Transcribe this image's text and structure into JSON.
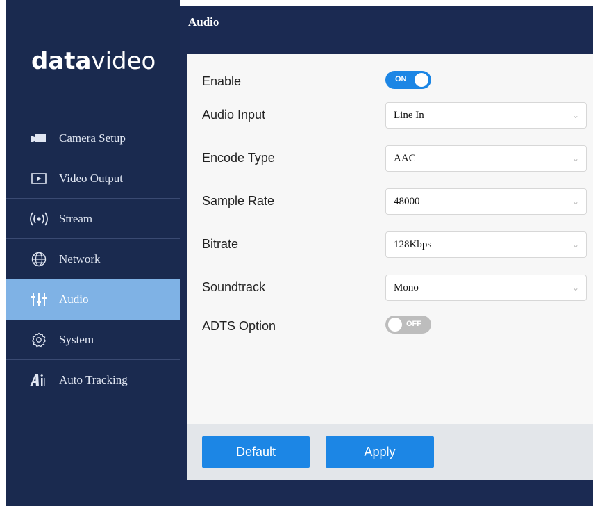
{
  "app": {
    "logo_bold": "data",
    "logo_light": "video",
    "accent": "#1c86e5",
    "sidebar_bg": "#1a2a4f",
    "active_bg": "#7fb2e5"
  },
  "sidebar": {
    "items": [
      {
        "label": "Camera Setup",
        "icon": "camera-icon",
        "active": false
      },
      {
        "label": "Video Output",
        "icon": "video-output-icon",
        "active": false
      },
      {
        "label": "Stream",
        "icon": "stream-icon",
        "active": false
      },
      {
        "label": "Network",
        "icon": "globe-icon",
        "active": false
      },
      {
        "label": "Audio",
        "icon": "audio-sliders-icon",
        "active": true
      },
      {
        "label": "System",
        "icon": "gear-icon",
        "active": false
      },
      {
        "label": "Auto Tracking",
        "icon": "ai-icon",
        "active": false
      }
    ]
  },
  "header": {
    "title": "Audio"
  },
  "form": {
    "enable": {
      "label": "Enable",
      "state": "ON"
    },
    "audio_input": {
      "label": "Audio Input",
      "value": "Line In"
    },
    "encode_type": {
      "label": "Encode Type",
      "value": "AAC"
    },
    "sample_rate": {
      "label": "Sample Rate",
      "value": "48000"
    },
    "bitrate": {
      "label": "Bitrate",
      "value": "128Kbps"
    },
    "soundtrack": {
      "label": "Soundtrack",
      "value": "Mono"
    },
    "adts_option": {
      "label": "ADTS Option",
      "state": "OFF"
    }
  },
  "footer": {
    "default_label": "Default",
    "apply_label": "Apply"
  }
}
